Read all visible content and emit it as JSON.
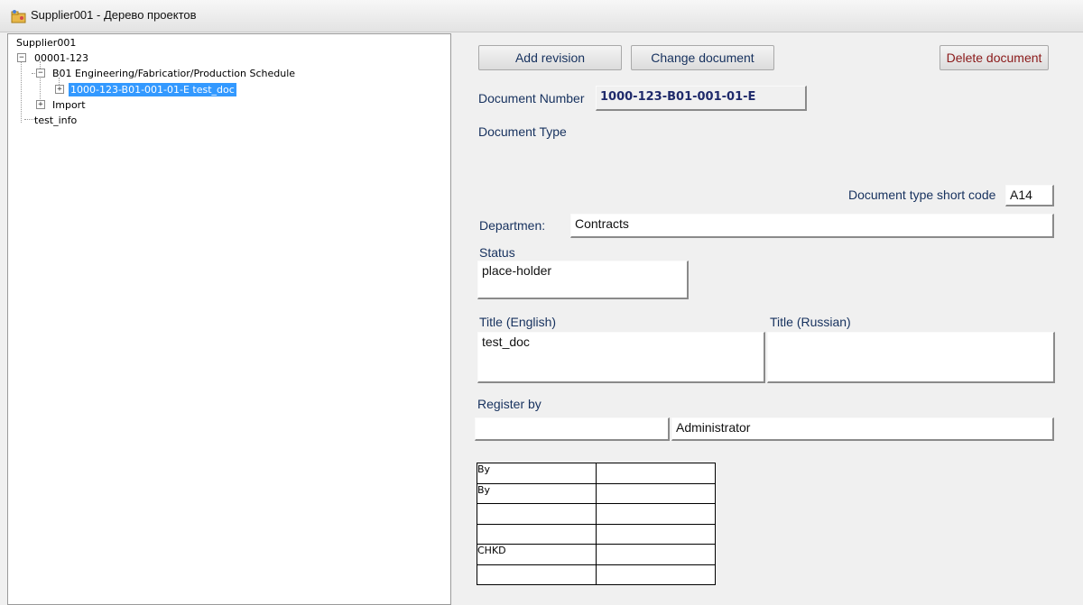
{
  "window": {
    "title": "Supplier001 - Дерево проектов",
    "icon": "tree-folder-icon"
  },
  "tree": {
    "root": "Supplier001",
    "project": "00001-123",
    "section": "B01 Engineering/Fabricatior/Production Schedule",
    "selected_document": "1000-123-B01-001-01-E test_doc",
    "import": "Import",
    "test_info": "test_info"
  },
  "toolbar": {
    "add_revision": "Add revision",
    "change_document": "Change document",
    "delete_document": "Delete document"
  },
  "form": {
    "document_number_label": "Document Number",
    "document_number_value": "1000-123-B01-001-01-E",
    "document_type_label": "Document Type",
    "doc_type_short_code_label": "Document type short code",
    "doc_type_short_code_value": "A14",
    "department_label": "Departmen:",
    "department_value": "Contracts",
    "status_label": "Status",
    "status_value": "place-holder",
    "title_english_label": "Title (English)",
    "title_english_value": "test_doc",
    "title_russian_label": "Title (Russian)",
    "title_russian_value": "",
    "register_by_label": "Register by",
    "register_by_left_value": "",
    "register_by_value": "Administrator"
  },
  "signature_grid": [
    [
      "By",
      ""
    ],
    [
      "By",
      ""
    ],
    [
      "",
      ""
    ],
    [
      "",
      ""
    ],
    [
      "CHKD",
      ""
    ],
    [
      "",
      ""
    ]
  ],
  "colors": {
    "label_blue": "#16315e",
    "selection": "#3399ff",
    "delete_red": "#8b1a1a"
  }
}
